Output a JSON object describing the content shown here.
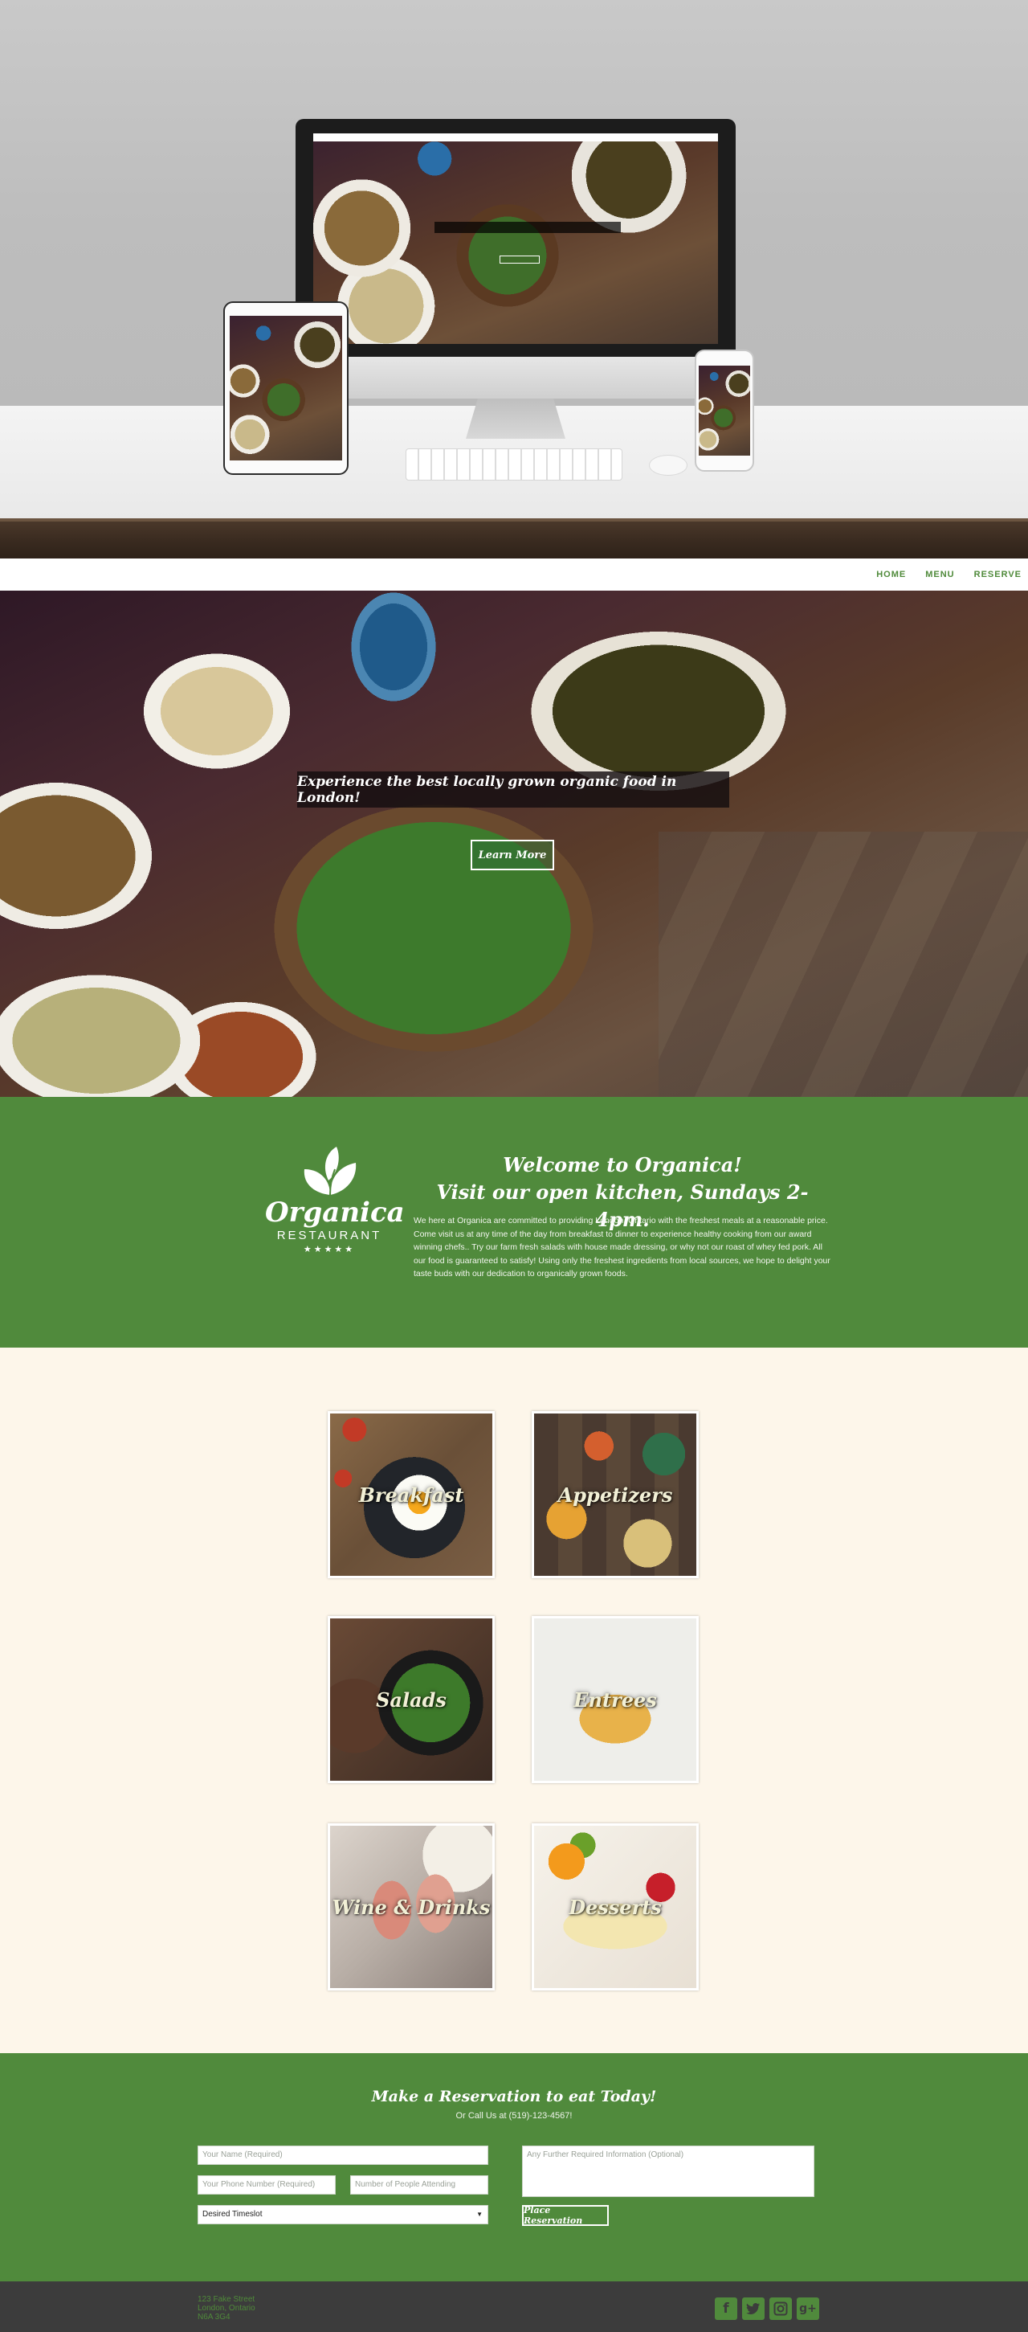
{
  "nav": {
    "items": [
      "HOME",
      "MENU",
      "RESERVE"
    ]
  },
  "hero": {
    "tagline": "Experience the best locally grown organic food in London!",
    "button_label": "Learn More"
  },
  "welcome": {
    "logo_name": "Organica",
    "logo_sub": "RESTAURANT",
    "logo_stars": "★★★★★",
    "title_line1": "Welcome to Organica!",
    "title_line2": "Visit our open kitchen, Sundays 2-4pm.",
    "body": "We here at Organica are committed to providing London, Ontario with the freshest meals at a reasonable price. Come visit us at any time of the day from breakfast to dinner to experience healthy cooking from our award winning chefs.. Try our farm fresh salads with house made dressing, or why not our roast of whey fed pork. All our food is guaranteed to satisfy! Using only the freshest ingredients from local sources, we hope to delight your taste buds with our dedication to organically grown foods."
  },
  "menu": {
    "tiles": [
      "Breakfast",
      "Appetizers",
      "Salads",
      "Entrees",
      "Wine & Drinks",
      "Desserts"
    ]
  },
  "reservation": {
    "title": "Make a Reservation to eat Today!",
    "call": "Or Call Us at (519)-123-4567!",
    "name_placeholder": "Your Name (Required)",
    "phone_placeholder": "Your Phone Number (Required)",
    "people_placeholder": "Number of People Attending",
    "timeslot_value": "Desired Timeslot",
    "info_placeholder": "Any Further Required Information (Optional)",
    "submit_label": "Place Reservation"
  },
  "footer": {
    "address_line1": "123 Fake Street",
    "address_line2": "London, Ontario",
    "address_line3": "N6A 3G4",
    "social_icons": [
      "facebook-icon",
      "twitter-icon",
      "instagram-icon",
      "google-plus-icon"
    ]
  },
  "colors": {
    "brand_green": "#508a3c",
    "cream": "#fdf6ea",
    "footer_dark": "#3c3c3c"
  }
}
